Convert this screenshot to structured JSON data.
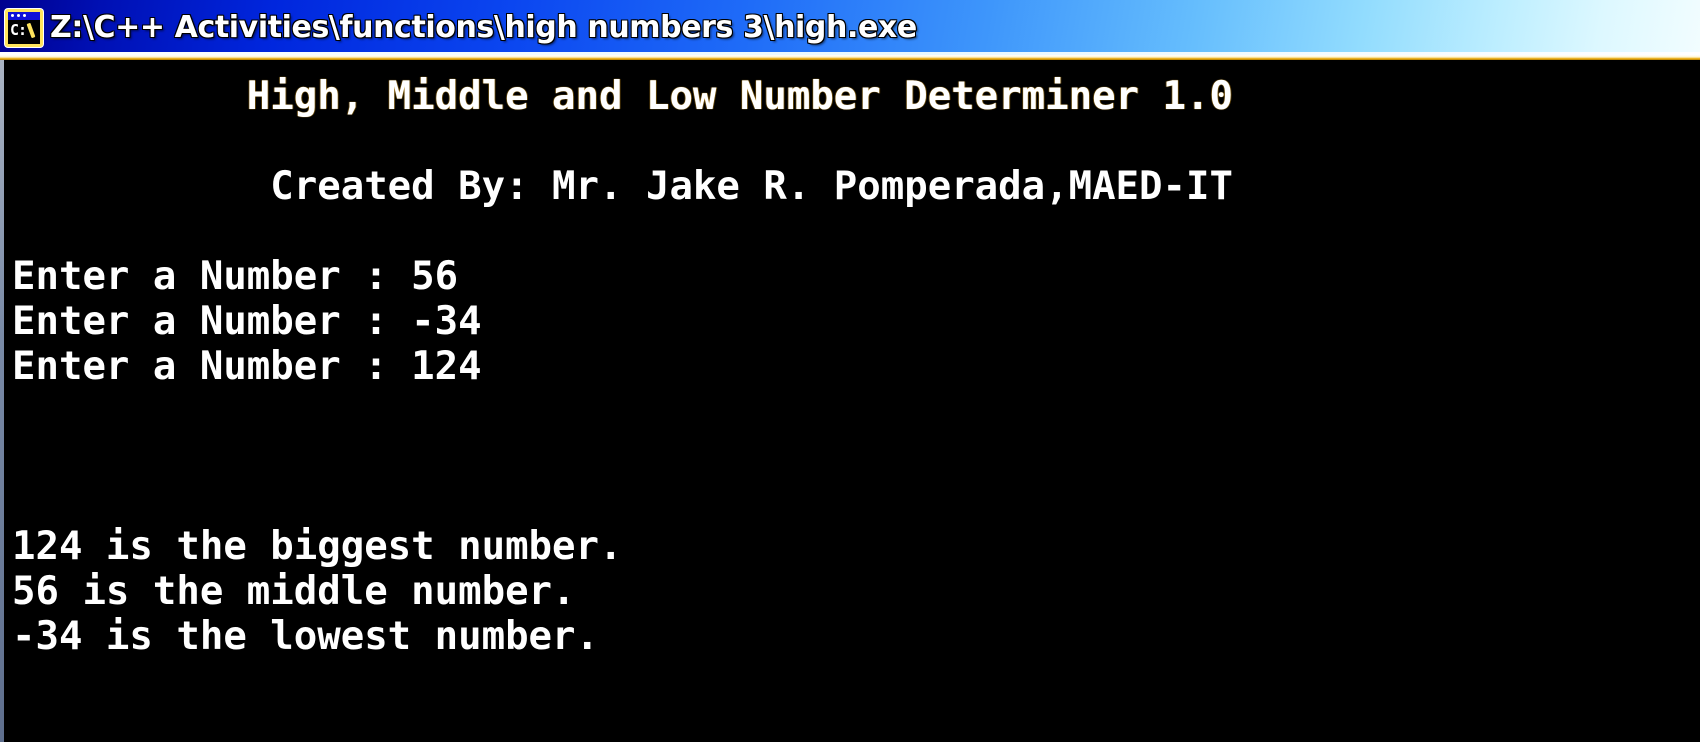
{
  "window": {
    "title": "Z:\\C++ Activities\\functions\\high numbers 3\\high.exe",
    "icon_name": "console-window-icon",
    "icon_prompt_text": "C:",
    "titlebar_gradient_start": "#00008f",
    "titlebar_gradient_end": "#f2fdff",
    "client_background": "#000000",
    "text_color": "#ffffff",
    "accent_underline_color": "#e8a708"
  },
  "console": {
    "lines": [
      {
        "text": "          High, Middle and Low Number Determiner 1.0",
        "style": "header"
      },
      {
        "text": "",
        "style": "blank"
      },
      {
        "text": "           Created By: Mr. Jake R. Pomperada,MAED-IT",
        "style": "normal"
      },
      {
        "text": "",
        "style": "blank"
      },
      {
        "text": "Enter a Number : 56",
        "style": "normal"
      },
      {
        "text": "Enter a Number : -34",
        "style": "normal"
      },
      {
        "text": "Enter a Number : 124",
        "style": "normal"
      },
      {
        "text": "",
        "style": "blank"
      },
      {
        "text": "",
        "style": "blank"
      },
      {
        "text": "",
        "style": "blank"
      },
      {
        "text": "124 is the biggest number.",
        "style": "normal"
      },
      {
        "text": "56 is the middle number.",
        "style": "normal"
      },
      {
        "text": "-34 is the lowest number.",
        "style": "normal"
      }
    ],
    "program_title": "High, Middle and Low Number Determiner 1.0",
    "author_line": "Created By: Mr. Jake R. Pomperada,MAED-IT",
    "prompts": [
      {
        "label": "Enter a Number :",
        "value": "56"
      },
      {
        "label": "Enter a Number :",
        "value": "-34"
      },
      {
        "label": "Enter a Number :",
        "value": "124"
      }
    ],
    "results": [
      {
        "value": "124",
        "text": "124 is the biggest number."
      },
      {
        "value": "56",
        "text": "56 is the middle number."
      },
      {
        "value": "-34",
        "text": "-34 is the lowest number."
      }
    ]
  }
}
